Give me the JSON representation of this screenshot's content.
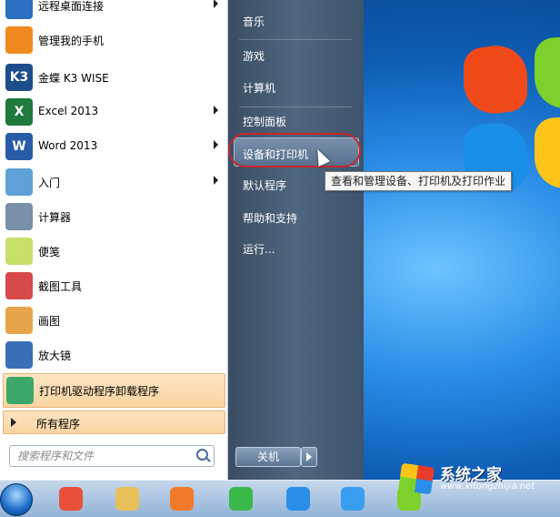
{
  "left_programs": [
    {
      "label": "远程桌面连接",
      "icon": "remote-desktop-icon",
      "color": "#2a6fc0",
      "arrow": true
    },
    {
      "label": "管理我的手机",
      "icon": "phone-manager-icon",
      "color": "#f08a1e",
      "arrow": false
    },
    {
      "label": "金蝶 K3 WISE",
      "icon": "kingdee-k3-icon",
      "color": "#1e4d8c",
      "arrow": false,
      "glyph": "K3"
    },
    {
      "label": "Excel 2013",
      "icon": "excel-icon",
      "color": "#1f7a3e",
      "arrow": true,
      "glyph": "X"
    },
    {
      "label": "Word 2013",
      "icon": "word-icon",
      "color": "#2a5ba8",
      "arrow": true,
      "glyph": "W"
    },
    {
      "label": "入门",
      "icon": "getting-started-icon",
      "color": "#5fa0d8",
      "arrow": true
    },
    {
      "label": "计算器",
      "icon": "calculator-icon",
      "color": "#7a8fa8",
      "arrow": false
    },
    {
      "label": "便笺",
      "icon": "sticky-notes-icon",
      "color": "#c6e06a",
      "arrow": false
    },
    {
      "label": "截图工具",
      "icon": "snipping-tool-icon",
      "color": "#d84a4a",
      "arrow": false
    },
    {
      "label": "画图",
      "icon": "paint-icon",
      "color": "#e8a44a",
      "arrow": false
    },
    {
      "label": "放大镜",
      "icon": "magnifier-icon",
      "color": "#3a6fb8",
      "arrow": false
    },
    {
      "label": "打印机驱动程序卸载程序",
      "icon": "printer-uninstall-icon",
      "color": "#3ba86a",
      "arrow": false,
      "highlighted": true
    }
  ],
  "all_programs_label": "所有程序",
  "search_placeholder": "搜索程序和文件",
  "right_links": [
    {
      "label": "音乐",
      "name": "music"
    },
    {
      "label": "游戏",
      "name": "games"
    },
    {
      "label": "计算机",
      "name": "computer"
    },
    {
      "label": "控制面板",
      "name": "control-panel"
    },
    {
      "label": "设备和打印机",
      "name": "devices-and-printers",
      "highlighted": true
    },
    {
      "label": "默认程序",
      "name": "default-programs"
    },
    {
      "label": "帮助和支持",
      "name": "help-and-support"
    },
    {
      "label": "运行...",
      "name": "run"
    }
  ],
  "shutdown_label": "关机",
  "tooltip": "查看和管理设备、打印机及打印作业",
  "taskbar_items": [
    {
      "icon": "start-orb-icon"
    },
    {
      "icon": "colorful-app-icon",
      "color": "#e8503a"
    },
    {
      "icon": "file-explorer-icon",
      "color": "#e8c05a"
    },
    {
      "icon": "media-player-icon",
      "color": "#f07a2a"
    },
    {
      "icon": "internet-explorer-icon",
      "color": "#3ab84a"
    },
    {
      "icon": "cloud-app-icon",
      "color": "#2a8ee8"
    },
    {
      "icon": "baidu-cloud-icon",
      "color": "#3a9ef0"
    },
    {
      "icon": "windows-flag-icon",
      "color": "#7ed12a"
    }
  ],
  "watermark": {
    "title": "系统之家",
    "url": "www.xitongzhijia.net"
  }
}
